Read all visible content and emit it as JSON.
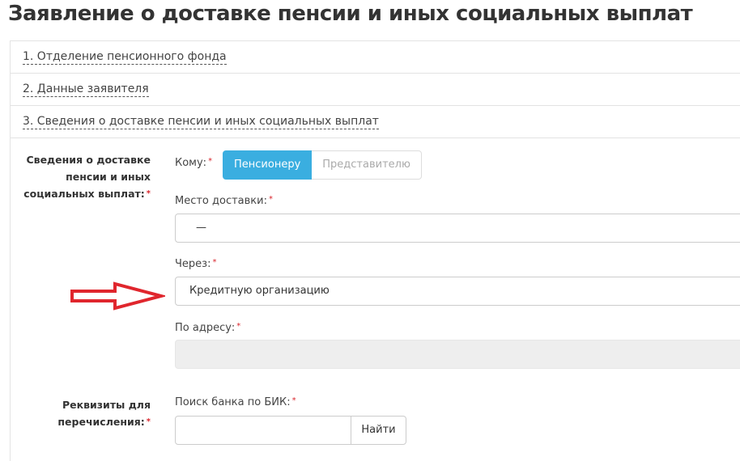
{
  "title": "Заявление о доставке пенсии и иных социальных выплат",
  "sections": [
    "1. Отделение пенсионного фонда",
    "2. Данные заявителя",
    "3. Сведения о доставке пенсии и иных социальных выплат"
  ],
  "form": {
    "group1_label": "Сведения о доставке пенсии и иных социальных выплат:",
    "to_label": "Кому:",
    "to_options": [
      "Пенсионеру",
      "Представителю"
    ],
    "place_label": "Место доставки:",
    "place_value": "—",
    "via_label": "Через:",
    "via_value": "Кредитную организацию",
    "address_label": "По адресу:",
    "address_value": "",
    "group2_label": "Реквизиты для перечисления:",
    "bik_label": "Поиск банка по БИК:",
    "bik_value": "",
    "find_button": "Найти",
    "required_mark": "*"
  },
  "colors": {
    "accent": "#3aaee0",
    "arrow": "#e0262d",
    "required": "#d9262d"
  }
}
